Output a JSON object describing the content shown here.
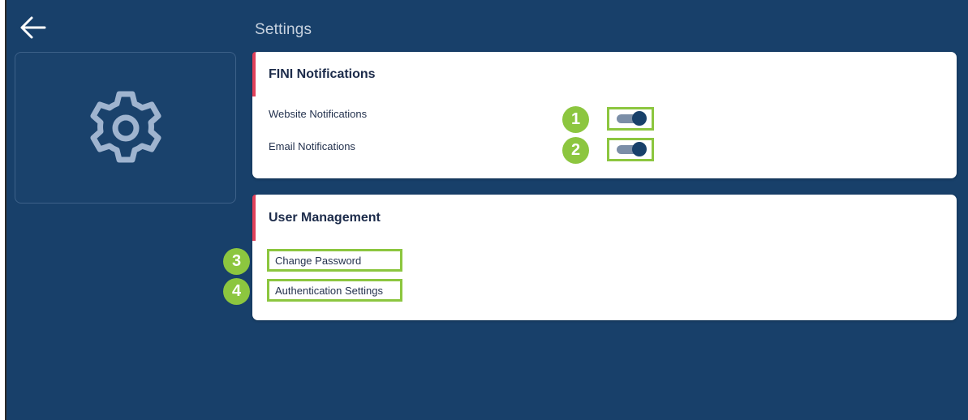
{
  "header": {
    "back_icon": "arrow-left-icon",
    "title": "Settings"
  },
  "sidebar": {
    "icon": "gear-icon"
  },
  "notifications": {
    "title": "FINI Notifications",
    "items": [
      {
        "label": "Website Notifications",
        "badge": "1",
        "enabled": true
      },
      {
        "label": "Email Notifications",
        "badge": "2",
        "enabled": true
      }
    ]
  },
  "user_management": {
    "title": "User Management",
    "links": [
      {
        "label": "Change Password",
        "badge": "3"
      },
      {
        "label": "Authentication Settings",
        "badge": "4"
      }
    ]
  },
  "colors": {
    "background": "#18406a",
    "accent": "#e0405a",
    "highlight": "#8cc63f",
    "toggle_knob": "#18406a"
  }
}
